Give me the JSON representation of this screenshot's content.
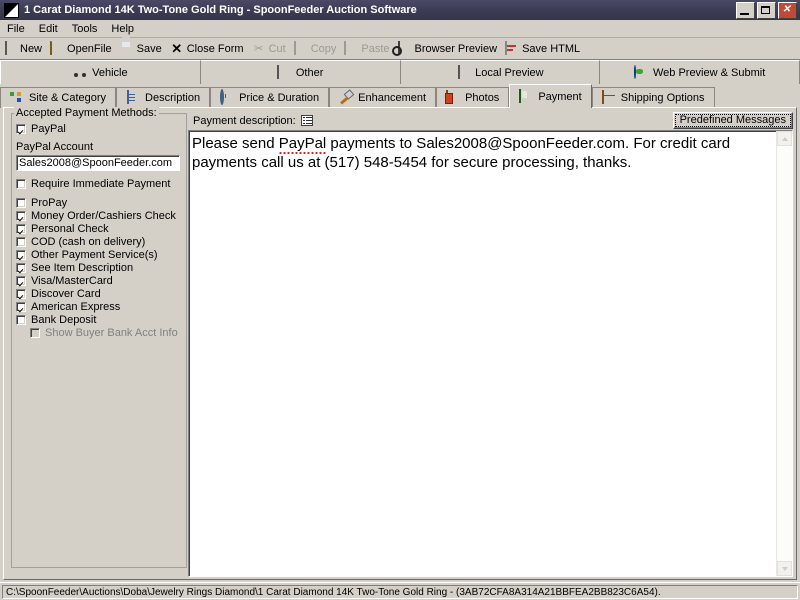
{
  "window": {
    "title": "1 Carat Diamond 14K Two-Tone Gold Ring - SpoonFeeder Auction Software",
    "app_icon": "app-diagonal-icon",
    "minimize_label": "_",
    "maximize_label": "□",
    "close_label": "✕"
  },
  "menu": {
    "items": [
      {
        "label": "File"
      },
      {
        "label": "Edit"
      },
      {
        "label": "Tools"
      },
      {
        "label": "Help"
      }
    ]
  },
  "toolbar": {
    "buttons": [
      {
        "label": "New",
        "icon": "new-page-icon",
        "enabled": true
      },
      {
        "label": "OpenFile",
        "icon": "open-folder-icon",
        "enabled": true
      },
      {
        "label": "Save",
        "icon": "save-disk-icon",
        "enabled": true
      },
      {
        "label": "Close Form",
        "icon": "close-x-icon",
        "enabled": true
      },
      {
        "label": "Cut",
        "icon": "scissors-icon",
        "enabled": false
      },
      {
        "label": "Copy",
        "icon": "copy-icon",
        "enabled": false
      },
      {
        "label": "Paste",
        "icon": "paste-icon",
        "enabled": false
      },
      {
        "label": "Browser Preview",
        "icon": "browser-preview-icon",
        "enabled": true
      },
      {
        "label": "Save HTML",
        "icon": "save-html-icon",
        "enabled": true
      }
    ]
  },
  "tabs_primary": [
    {
      "label": "Vehicle",
      "icon": "vehicle-icon"
    },
    {
      "label": "Other",
      "icon": "barcode-icon"
    },
    {
      "label": "Local Preview",
      "icon": "monitor-icon"
    },
    {
      "label": "Web Preview & Submit",
      "icon": "globe-icon"
    }
  ],
  "tabs_secondary": [
    {
      "label": "Site & Category",
      "icon": "sitemap-icon",
      "active": false
    },
    {
      "label": "Description",
      "icon": "document-edit-icon",
      "active": false
    },
    {
      "label": "Price & Duration",
      "icon": "clock-icon",
      "active": false
    },
    {
      "label": "Enhancement",
      "icon": "wand-icon",
      "active": false
    },
    {
      "label": "Photos",
      "icon": "photos-icon",
      "active": false
    },
    {
      "label": "Payment",
      "icon": "payment-icon",
      "active": true
    },
    {
      "label": "Shipping Options",
      "icon": "box-icon",
      "active": false
    }
  ],
  "payment_panel": {
    "group_title": "Accepted Payment Methods:",
    "paypal": {
      "label": "PayPal",
      "checked": true
    },
    "paypal_account_label": "PayPal Account",
    "paypal_account_value": "Sales2008@SpoonFeeder.com",
    "require_immediate": {
      "label": "Require Immediate Payment",
      "checked": false
    },
    "methods": [
      {
        "label": "ProPay",
        "checked": false
      },
      {
        "label": "Money Order/Cashiers Check",
        "checked": true
      },
      {
        "label": "Personal Check",
        "checked": true
      },
      {
        "label": "COD (cash on delivery)",
        "checked": false
      },
      {
        "label": "Other Payment Service(s)",
        "checked": true
      },
      {
        "label": "See Item Description",
        "checked": true
      },
      {
        "label": "Visa/MasterCard",
        "checked": true
      },
      {
        "label": "Discover Card",
        "checked": true
      },
      {
        "label": "American Express",
        "checked": true
      },
      {
        "label": "Bank Deposit",
        "checked": false
      }
    ],
    "show_bank_acct": {
      "label": "Show Buyer Bank Acct Info",
      "checked": false,
      "disabled": true
    }
  },
  "description_pane": {
    "label": "Payment description:",
    "list_icon": "bulleted-list-icon",
    "predefined_button": "Predefined Messages",
    "text_line1_a": "Please send ",
    "text_line1_spell": "PayPal",
    "text_line1_b": " payments to Sales2008@SpoonFeeder.com.  For credit card",
    "text_line2": "payments call us at (517) 548-5454 for secure processing, thanks."
  },
  "scrollbar": {
    "up_arrow": "scroll-up-arrow",
    "down_arrow": "scroll-down-arrow"
  },
  "statusbar": {
    "path": "C:\\SpoonFeeder\\Auctions\\Doba\\Jewelry Rings Diamond\\1 Carat Diamond 14K Two-Tone Gold Ring - (3AB72CFA8A314A21BBFEA2BB823C6A54)."
  }
}
